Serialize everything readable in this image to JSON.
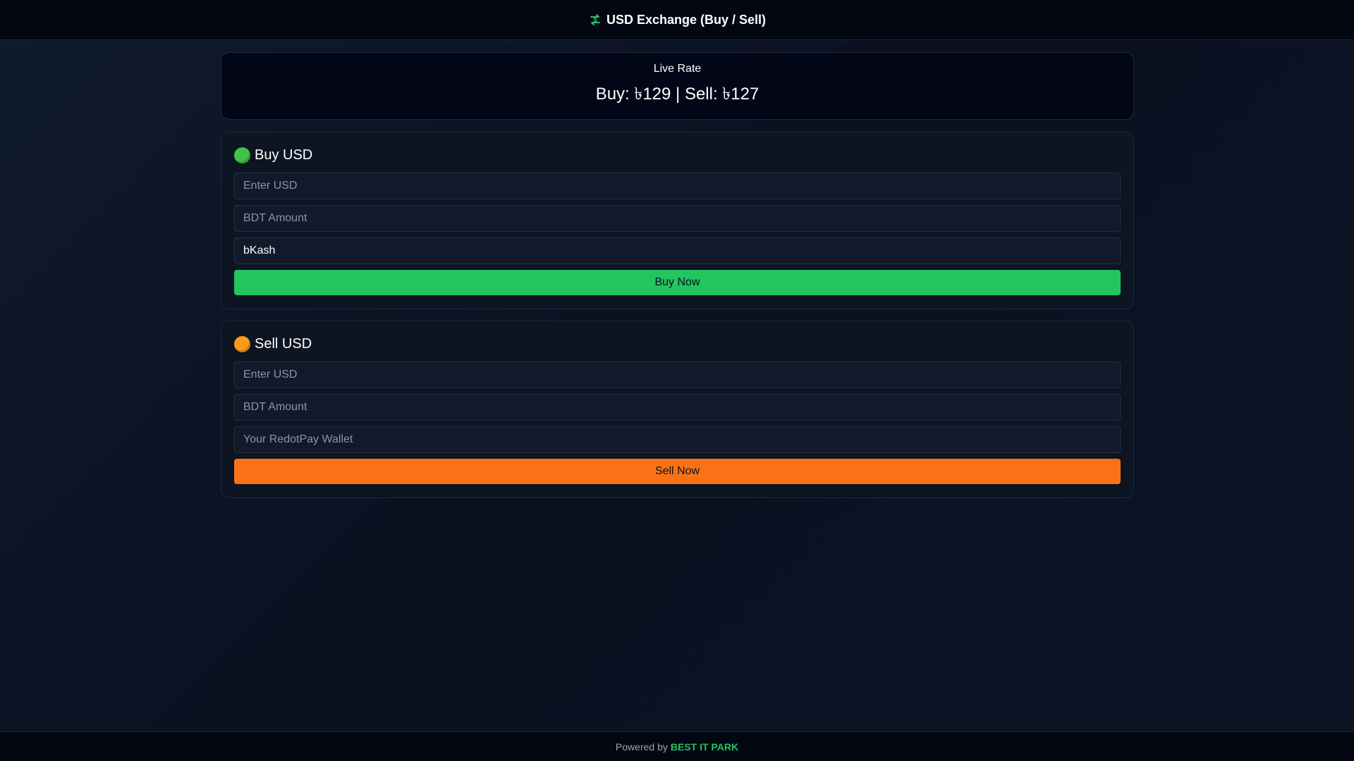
{
  "header": {
    "title": "USD Exchange (Buy / Sell)",
    "icon": "currency-exchange-icon"
  },
  "rate": {
    "label": "Live Rate",
    "value": "Buy: ৳129 | Sell: ৳127"
  },
  "buy": {
    "title": "Buy USD",
    "icon": "green-circle-icon",
    "usd_placeholder": "Enter USD",
    "bdt_placeholder": "BDT Amount",
    "method_value": "bKash",
    "button_label": "Buy Now",
    "accent": "#22c55e"
  },
  "sell": {
    "title": "Sell USD",
    "icon": "orange-circle-icon",
    "usd_placeholder": "Enter USD",
    "bdt_placeholder": "BDT Amount",
    "wallet_placeholder": "Your RedotPay Wallet",
    "button_label": "Sell Now",
    "accent": "#f97316"
  },
  "footer": {
    "prefix": "Powered by",
    "brand": "BEST IT PARK"
  }
}
